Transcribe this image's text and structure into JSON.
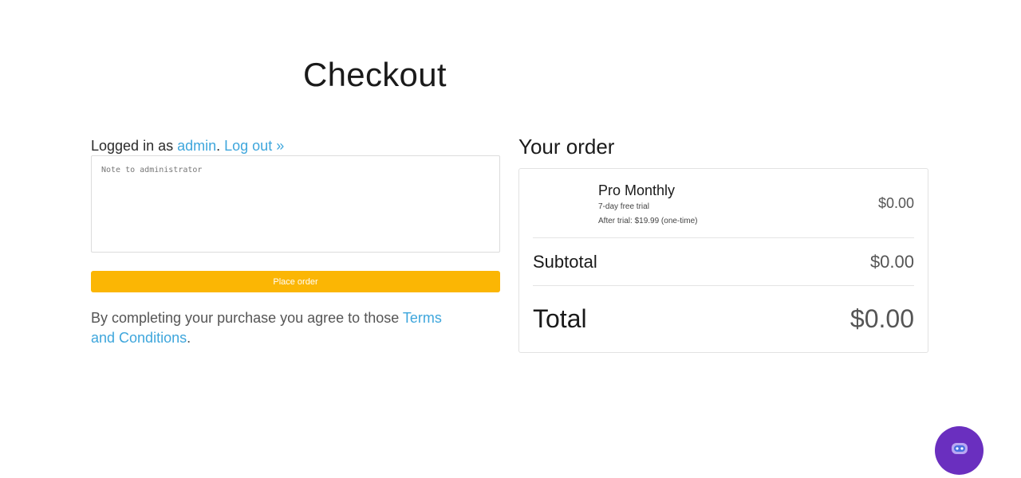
{
  "page": {
    "title": "Checkout"
  },
  "login": {
    "prefix": "Logged in as ",
    "username": "admin",
    "separator": ". ",
    "logout_label": "Log out »"
  },
  "note": {
    "placeholder": "Note to administrator",
    "value": ""
  },
  "actions": {
    "place_order_label": "Place order"
  },
  "terms": {
    "prefix": "By completing your purchase you agree to those ",
    "link_label": "Terms and Conditions",
    "suffix": "."
  },
  "order": {
    "heading": "Your order",
    "product": {
      "name": "Pro Monthly",
      "trial": "7-day free trial",
      "after_trial": "After trial: $19.99 (one-time)",
      "price": "$0.00"
    },
    "subtotal_label": "Subtotal",
    "subtotal_value": "$0.00",
    "total_label": "Total",
    "total_value": "$0.00"
  },
  "chat": {
    "icon": "chat-bot-icon",
    "color": "#6a2fbf"
  },
  "colors": {
    "link": "#3ea6dc",
    "place_order_button": "#fbb604"
  }
}
